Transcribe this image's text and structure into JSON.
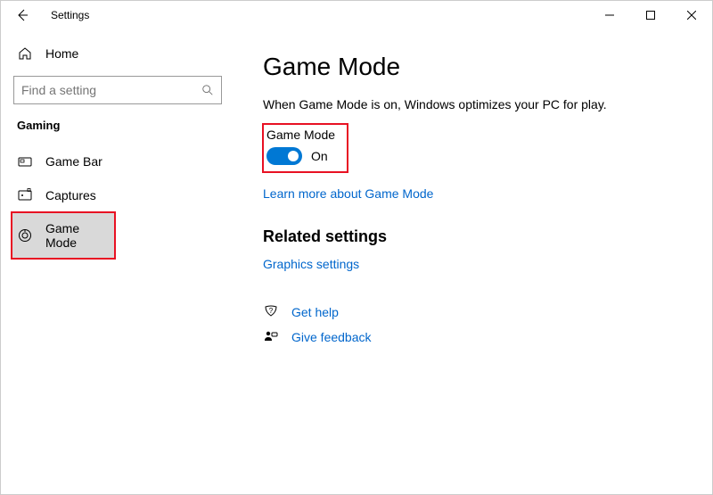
{
  "window": {
    "title": "Settings"
  },
  "sidebar": {
    "home": "Home",
    "searchPlaceholder": "Find a setting",
    "category": "Gaming",
    "items": [
      {
        "label": "Game Bar"
      },
      {
        "label": "Captures"
      },
      {
        "label": "Game Mode"
      }
    ]
  },
  "main": {
    "title": "Game Mode",
    "description": "When Game Mode is on, Windows optimizes your PC for play.",
    "toggle": {
      "label": "Game Mode",
      "state": "On"
    },
    "learnMore": "Learn more about Game Mode",
    "related": {
      "header": "Related settings",
      "graphics": "Graphics settings"
    },
    "help": {
      "getHelp": "Get help",
      "feedback": "Give feedback"
    }
  }
}
